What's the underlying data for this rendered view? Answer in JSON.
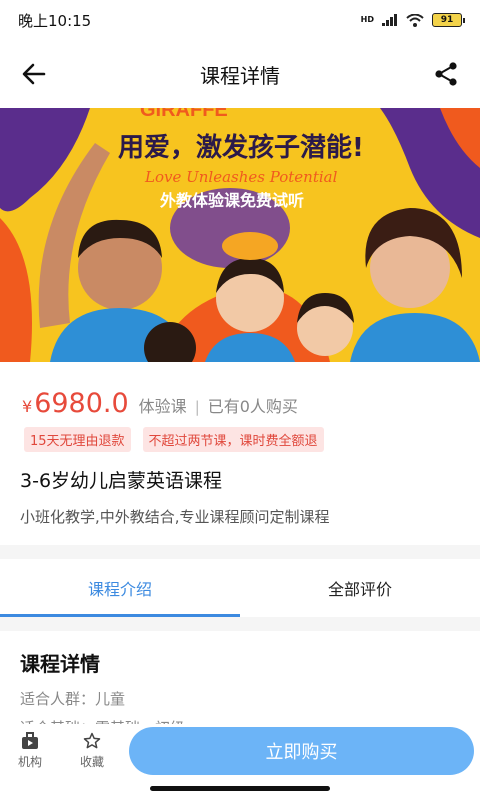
{
  "status_bar": {
    "time": "晚上10:15",
    "network": "HD",
    "battery": "91"
  },
  "header": {
    "title": "课程详情",
    "back_icon": "arrow-left-icon",
    "share_icon": "share-icon"
  },
  "banner": {
    "brand": "GIRAFFE",
    "slogan": "用爱，激发孩子潜能!",
    "slogan_en": "Love Unleashes Potential",
    "subtitle": "外教体验课免费试听",
    "colors": {
      "yellow": "#f7c41f",
      "orange": "#f05a1e",
      "purple": "#5a2d8c",
      "blue": "#2e8fd6"
    }
  },
  "price": {
    "symbol": "¥",
    "value": "6980.0",
    "type": "体验课",
    "separator": "|",
    "bought": "已有0人购买"
  },
  "tags": [
    "15天无理由退款",
    "不超过两节课，课时费全额退"
  ],
  "course": {
    "name": "3-6岁幼儿启蒙英语课程",
    "description": "小班化教学,中外教结合,专业课程顾问定制课程"
  },
  "tabs": [
    {
      "label": "课程介绍",
      "active": true
    },
    {
      "label": "全部评价",
      "active": false
    }
  ],
  "detail": {
    "title": "课程详情",
    "lines": [
      "适合人群：儿童",
      "适合基础：零基础、初级"
    ]
  },
  "bottom_bar": {
    "org_label": "机构",
    "fav_label": "收藏",
    "buy_label": "立即购买"
  },
  "colors": {
    "accent": "#3c8ae0",
    "price": "#e74a3b",
    "buy_button": "#6cb4f7",
    "tag_bg": "#fde4e3"
  }
}
